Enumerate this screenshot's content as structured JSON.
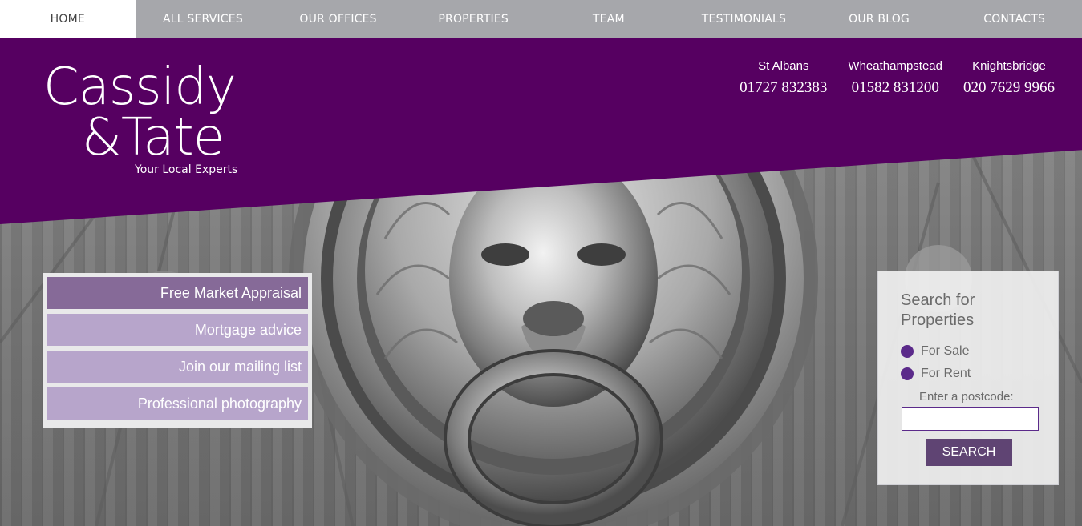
{
  "nav": {
    "items": [
      {
        "label": "HOME",
        "active": true
      },
      {
        "label": "ALL SERVICES",
        "active": false
      },
      {
        "label": "OUR OFFICES",
        "active": false
      },
      {
        "label": "PROPERTIES",
        "active": false
      },
      {
        "label": "TEAM",
        "active": false
      },
      {
        "label": "TESTIMONIALS",
        "active": false
      },
      {
        "label": "OUR BLOG",
        "active": false
      },
      {
        "label": "CONTACTS",
        "active": false
      }
    ]
  },
  "brand": {
    "line1": "Cassidy",
    "line2": "&Tate",
    "tagline": "Your Local Experts",
    "purple": "#560061"
  },
  "offices": [
    {
      "name": "St Albans",
      "phone": "01727 832383"
    },
    {
      "name": "Wheathampstead",
      "phone": "01582 831200"
    },
    {
      "name": "Knightsbridge",
      "phone": "020 7629 9966"
    }
  ],
  "services": [
    {
      "label": "Free Market Appraisal"
    },
    {
      "label": "Mortgage advice"
    },
    {
      "label": "Join our mailing list"
    },
    {
      "label": "Professional photography"
    }
  ],
  "search": {
    "title_line1": "Search for",
    "title_line2": "Properties",
    "option_sale": "For Sale",
    "option_rent": "For Rent",
    "postcode_label": "Enter a postcode:",
    "postcode_value": "",
    "button_label": "SEARCH"
  },
  "hero": {
    "image": "lion-head-door-knocker"
  }
}
